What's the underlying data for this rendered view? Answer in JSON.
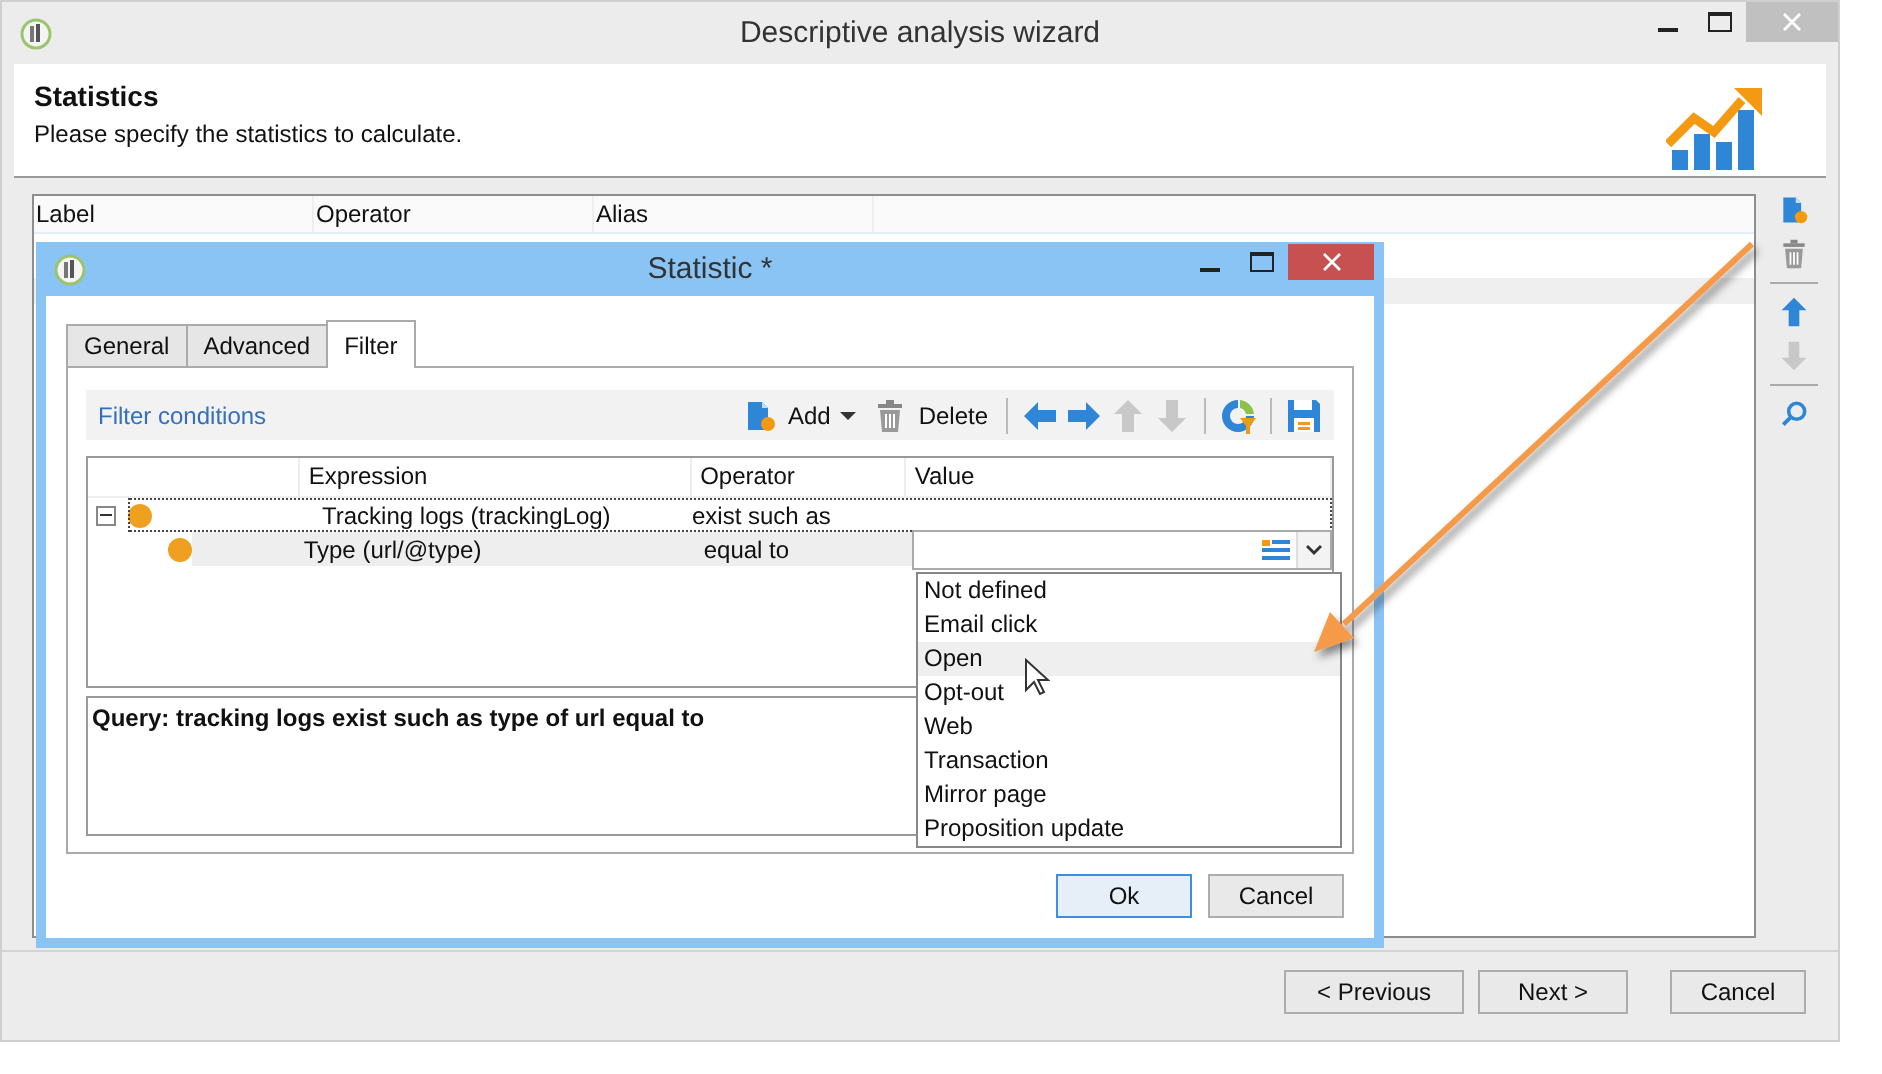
{
  "window": {
    "title": "Descriptive analysis wizard"
  },
  "header": {
    "title": "Statistics",
    "subtitle": "Please specify the statistics to calculate."
  },
  "statistics_list": {
    "columns": [
      "Label",
      "Operator",
      "Alias"
    ]
  },
  "side_toolbar": [
    {
      "kind": "add",
      "disabled": false
    },
    {
      "kind": "delete",
      "disabled": false
    },
    {
      "kind": "up",
      "disabled": false
    },
    {
      "kind": "down",
      "disabled": true
    },
    {
      "kind": "search",
      "disabled": false
    }
  ],
  "dialog": {
    "title": "Statistic *",
    "tabs": [
      {
        "label": "General",
        "selected": false
      },
      {
        "label": "Advanced",
        "selected": false
      },
      {
        "label": "Filter",
        "selected": true
      }
    ],
    "filter_conditions": "Filter conditions",
    "toolbar": [
      {
        "kind": "add",
        "label": "Add",
        "disabled": false
      },
      {
        "kind": "delete",
        "label": "Delete",
        "disabled": false
      },
      {
        "kind": "left",
        "disabled": false
      },
      {
        "kind": "right",
        "disabled": false
      },
      {
        "kind": "up",
        "disabled": true
      },
      {
        "kind": "down",
        "disabled": true
      },
      {
        "kind": "filter",
        "disabled": false
      },
      {
        "kind": "save",
        "disabled": false
      }
    ],
    "tree": {
      "columns": [
        "Expression",
        "Operator",
        "Value"
      ],
      "rows": [
        {
          "expression": "Tracking logs (trackingLog)",
          "operator": "exist such as",
          "expanded": true,
          "selected": false,
          "children": [
            {
              "expression": "Type (url/@type)",
              "operator": "equal to",
              "selected": true
            }
          ]
        }
      ]
    },
    "value_dropdown": {
      "expanded": true,
      "options": [
        {
          "label": "Not defined",
          "selected": false
        },
        {
          "label": "Email click",
          "selected": false
        },
        {
          "label": "Open",
          "selected": true
        },
        {
          "label": "Opt-out",
          "selected": false
        },
        {
          "label": "Web",
          "selected": false
        },
        {
          "label": "Transaction",
          "selected": false
        },
        {
          "label": "Mirror page",
          "selected": false
        },
        {
          "label": "Proposition update",
          "selected": false
        }
      ]
    },
    "query": "Query: tracking logs exist such as type of url equal to",
    "buttons": [
      "Ok",
      "Cancel"
    ]
  },
  "footer_buttons": [
    "< Previous",
    "Next >",
    "Cancel"
  ]
}
